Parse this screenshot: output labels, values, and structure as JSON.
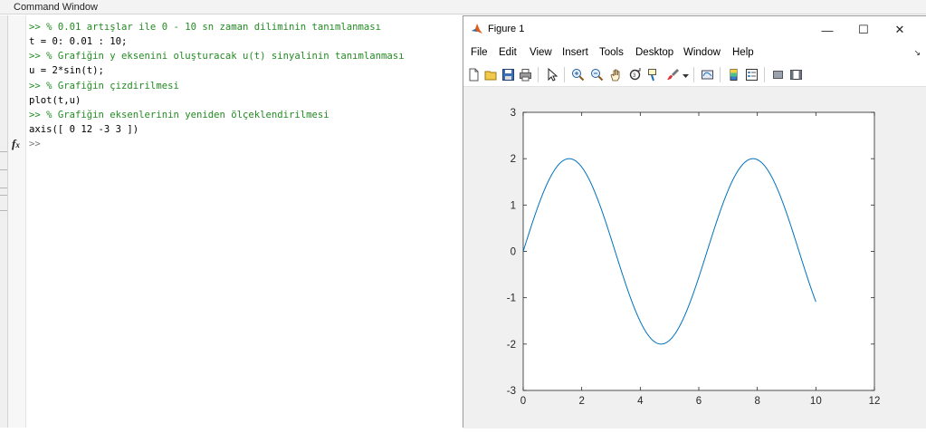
{
  "command_window": {
    "title": "Command Window",
    "lines": [
      {
        "kind": "comment",
        "text": ">> % 0.01 artışlar ile 0 - 10 sn zaman diliminin tanımlanması"
      },
      {
        "kind": "code",
        "text": "t = 0: 0.01 : 10;"
      },
      {
        "kind": "comment",
        "text": ">> % Grafiğin y eksenini oluşturacak u(t) sinyalinin tanımlanması"
      },
      {
        "kind": "code",
        "text": "u = 2*sin(t);"
      },
      {
        "kind": "comment",
        "text": ">> % Grafiğin çizdirilmesi"
      },
      {
        "kind": "code",
        "text": "plot(t,u)"
      },
      {
        "kind": "comment",
        "text": ">> % Grafiğin eksenlerinin yeniden ölçeklendirilmesi"
      },
      {
        "kind": "code",
        "text": "axis([ 0 12 -3 3 ])"
      }
    ],
    "prompt": ">>",
    "fx_icon": "fx-icon"
  },
  "figure": {
    "title": "Figure 1",
    "window_buttons": {
      "minimize": "—",
      "maximize": "☐",
      "close": "✕"
    },
    "menu": [
      "File",
      "Edit",
      "View",
      "Insert",
      "Tools",
      "Desktop",
      "Window",
      "Help"
    ],
    "dock_arrow": "↘",
    "toolbar_icons": [
      "new-figure-icon",
      "open-file-icon",
      "save-icon",
      "print-icon",
      "select-arrow-icon",
      "zoom-in-icon",
      "zoom-out-icon",
      "pan-hand-icon",
      "rotate-3d-icon",
      "data-cursor-icon",
      "brush-icon",
      "brush-dropdown-icon",
      "link-plot-icon",
      "colorbar-icon",
      "legend-icon",
      "hide-plot-tools-icon",
      "show-plot-tools-icon"
    ],
    "colors": {
      "line": "#0072bd",
      "axes_bg": "#ffffff",
      "figure_bg": "#f0f0f0"
    }
  },
  "chart_data": {
    "type": "line",
    "title": "",
    "xlabel": "",
    "ylabel": "",
    "xlim": [
      0,
      12
    ],
    "ylim": [
      -3,
      3
    ],
    "xticks": [
      "0",
      "2",
      "4",
      "6",
      "8",
      "10",
      "12"
    ],
    "yticks": [
      "3",
      "2",
      "1",
      "0",
      "-1",
      "-2",
      "-3"
    ],
    "grid": false,
    "series": [
      {
        "expression": "u = 2*sin(t)",
        "x_range": [
          0,
          10
        ],
        "x_step": 0.01,
        "x": [
          0,
          0.5,
          1,
          1.5,
          1.5708,
          2,
          2.5,
          3,
          3.5,
          4,
          4.5,
          4.7124,
          5,
          5.5,
          6,
          6.5,
          7,
          7.5,
          7.854,
          8,
          8.5,
          9,
          9.5,
          10
        ],
        "y": [
          0,
          0.959,
          1.683,
          1.995,
          2,
          1.819,
          1.197,
          0.282,
          -0.701,
          -1.514,
          -1.955,
          -2,
          -1.918,
          -1.411,
          -0.559,
          0.43,
          1.314,
          1.876,
          2,
          1.979,
          1.596,
          0.824,
          -0.15,
          -1.088
        ],
        "color": "#0072bd"
      }
    ]
  }
}
